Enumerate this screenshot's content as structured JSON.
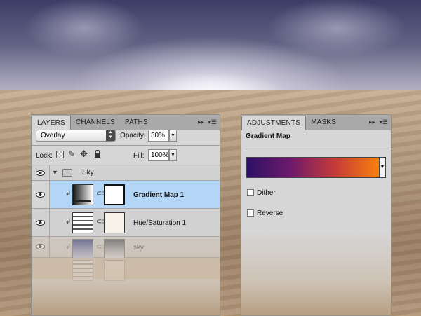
{
  "layers_panel": {
    "tabs": [
      "LAYERS",
      "CHANNELS",
      "PATHS"
    ],
    "collapse_glyph": "▸▸",
    "menu_glyph": "▾☰",
    "blend_mode": "Overlay",
    "opacity_label": "Opacity:",
    "opacity_value": "30%",
    "lock_label": "Lock:",
    "fill_label": "Fill:",
    "fill_value": "100%",
    "layers": [
      {
        "name": "Sky",
        "type": "group",
        "expanded": true,
        "visible": true
      },
      {
        "name": "Gradient Map 1",
        "type": "adjustment-gradient-map",
        "selected": true,
        "visible": true
      },
      {
        "name": "Hue/Saturation 1",
        "type": "adjustment-hue-saturation",
        "selected": false,
        "visible": true
      },
      {
        "name": "sky",
        "type": "image",
        "selected": false,
        "visible": true
      }
    ],
    "icons": {
      "eye": "eye-icon",
      "folder": "folder-icon",
      "link": "chain-link-icon",
      "clip": "clipping-arrow-icon",
      "lock_transparency": "lock-transparent-pixels-icon",
      "lock_brush": "lock-image-pixels-icon",
      "lock_move": "lock-position-icon",
      "lock_all": "lock-all-icon"
    }
  },
  "adjustments_panel": {
    "tabs": [
      "ADJUSTMENTS",
      "MASKS"
    ],
    "collapse_glyph": "▸▸",
    "menu_glyph": "▾☰",
    "title": "Gradient Map",
    "gradient_colors": [
      "#2d1066",
      "#6e1a6a",
      "#c73a3a",
      "#f7800a"
    ],
    "dither_label": "Dither",
    "dither_checked": false,
    "reverse_label": "Reverse",
    "reverse_checked": false
  },
  "colors": {
    "panel_bg": "#d6d6d6",
    "tabbar_bg": "#a9a9a9",
    "selection": "#b3d6f7"
  }
}
